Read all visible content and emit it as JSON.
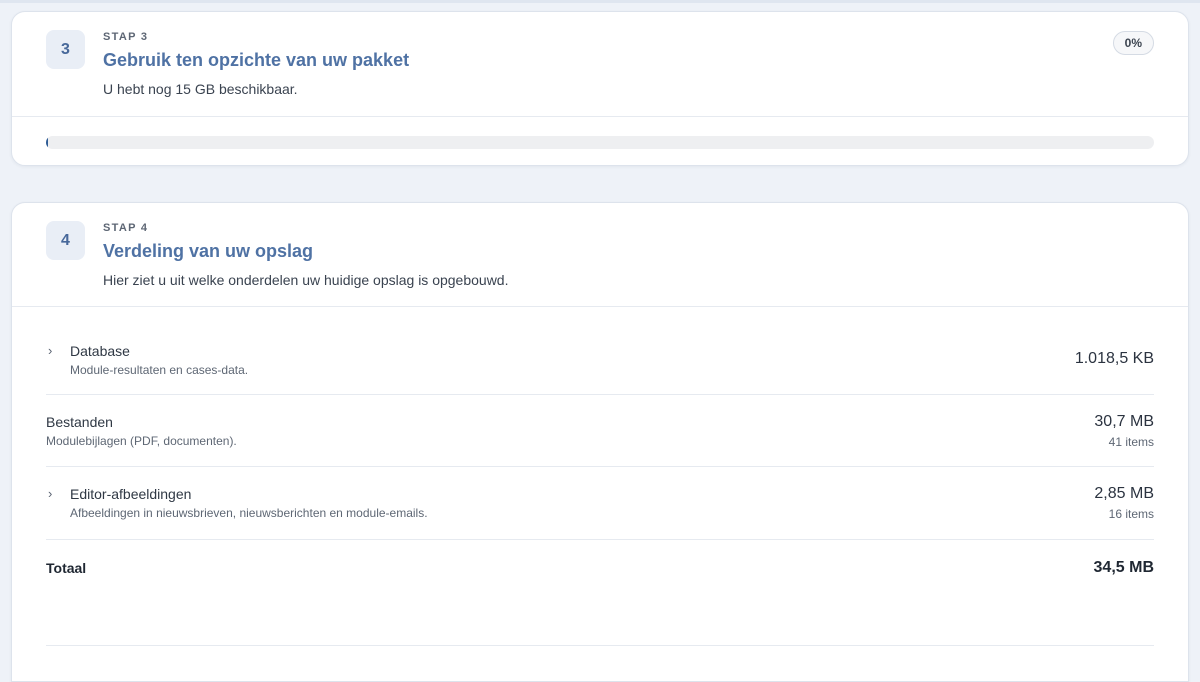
{
  "step3": {
    "number": "3",
    "label": "STAP 3",
    "title": "Gebruik ten opzichte van uw pakket",
    "description": "U hebt nog 15 GB beschikbaar.",
    "percent_label": "0%",
    "progress_fraction": 0
  },
  "step4": {
    "number": "4",
    "label": "STAP 4",
    "title": "Verdeling van uw opslag",
    "description": "Hier ziet u uit welke onderdelen uw huidige opslag is opgebouwd.",
    "rows": [
      {
        "name": "Database",
        "subtitle": "Module-resultaten en cases-data.",
        "size": "1.018,5 KB",
        "count": "",
        "expandable": true
      },
      {
        "name": "Bestanden",
        "subtitle": "Modulebijlagen (PDF, documenten).",
        "size": "30,7 MB",
        "count": "41 items",
        "expandable": false
      },
      {
        "name": "Editor-afbeeldingen",
        "subtitle": "Afbeeldingen in nieuwsbrieven, nieuwsberichten en module-emails.",
        "size": "2,85 MB",
        "count": "16 items",
        "expandable": true
      }
    ],
    "total": {
      "label": "Totaal",
      "size": "34,5 MB"
    }
  },
  "icons": {
    "expand": "chevron-right-icon"
  },
  "colors": {
    "accent": "#4f72a4",
    "progress": "#2f5c95",
    "background": "#eef2f8"
  }
}
